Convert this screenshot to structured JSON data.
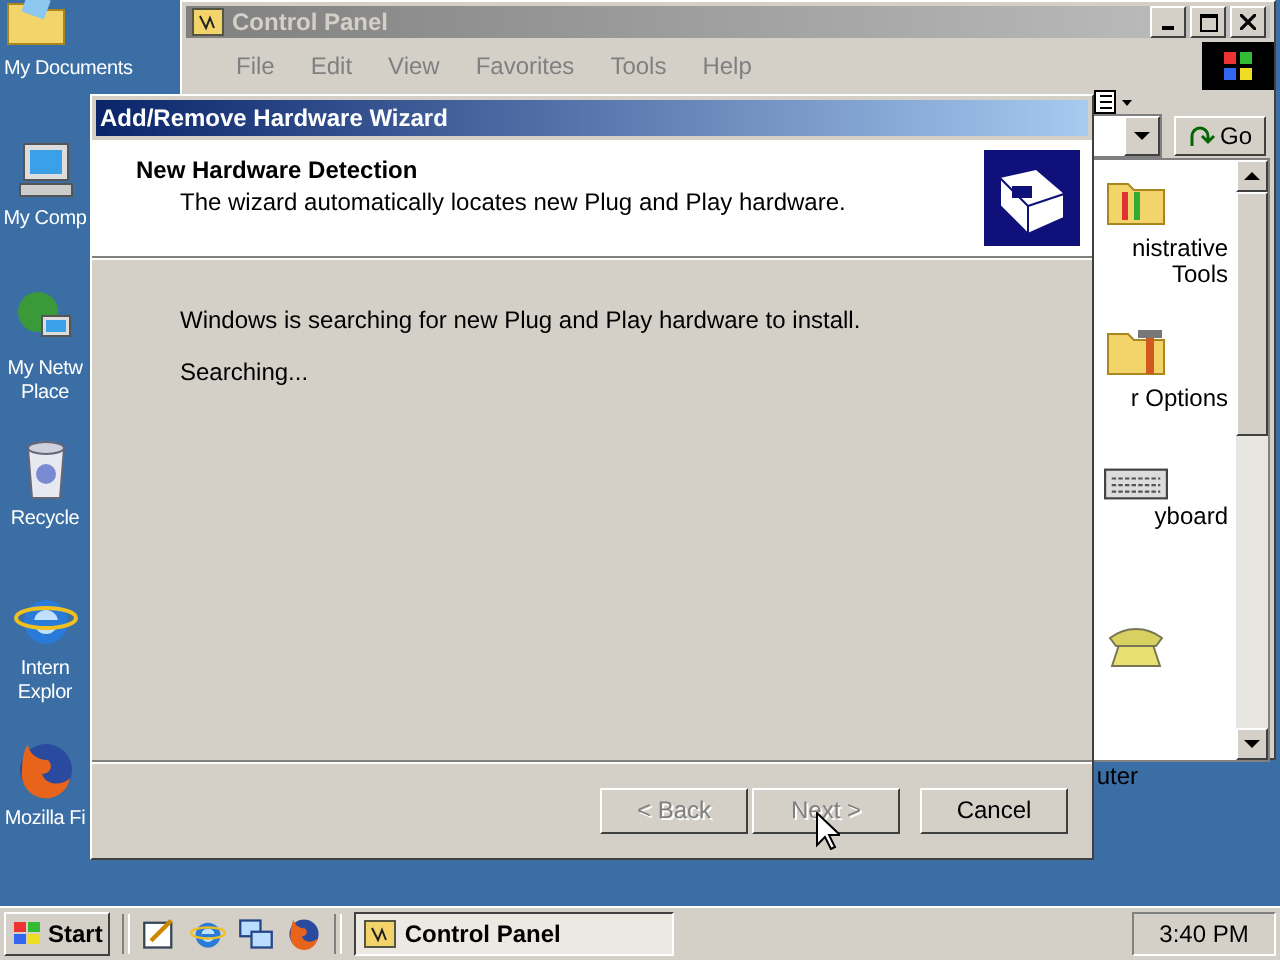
{
  "desktop_icons": [
    {
      "kind": "folder",
      "lines": [
        "My Documents"
      ]
    },
    {
      "kind": "computer",
      "lines": [
        "My Comp"
      ]
    },
    {
      "kind": "network",
      "lines": [
        "My Netw",
        "Place"
      ]
    },
    {
      "kind": "recycle",
      "lines": [
        "Recycle"
      ]
    },
    {
      "kind": "browser",
      "lines": [
        "Intern",
        "Explor"
      ]
    },
    {
      "kind": "fox",
      "lines": [
        "Mozilla Fi"
      ]
    }
  ],
  "control_panel": {
    "title": "Control Panel",
    "menu": [
      "File",
      "Edit",
      "View",
      "Favorites",
      "Tools",
      "Help"
    ],
    "go": "Go",
    "items": [
      {
        "kind": "tools",
        "lines": [
          "nistrative",
          "Tools"
        ]
      },
      {
        "kind": "options",
        "lines": [
          "r Options"
        ]
      },
      {
        "kind": "keyboard",
        "lines": [
          "yboard"
        ]
      },
      {
        "kind": "phone"
      }
    ],
    "status": "uter"
  },
  "wizard": {
    "title": "Add/Remove Hardware Wizard",
    "heading": "New Hardware Detection",
    "subtitle": "The wizard automatically locates new Plug and Play hardware.",
    "message": "Windows is searching for new Plug and Play hardware to install.",
    "status": "Searching...",
    "buttons": [
      {
        "label": "< Back",
        "disabled": true
      },
      {
        "label": "Next >",
        "disabled": true
      },
      {
        "label": "Cancel",
        "disabled": false
      }
    ]
  },
  "taskbar": {
    "start": "Start",
    "quick_launch": [
      {
        "kind": "desktop"
      },
      {
        "kind": "browser"
      },
      {
        "kind": "switch"
      },
      {
        "kind": "fox"
      }
    ],
    "tasks": [
      {
        "label": "Control Panel",
        "selected": true
      }
    ],
    "clock": "3:40 PM"
  }
}
